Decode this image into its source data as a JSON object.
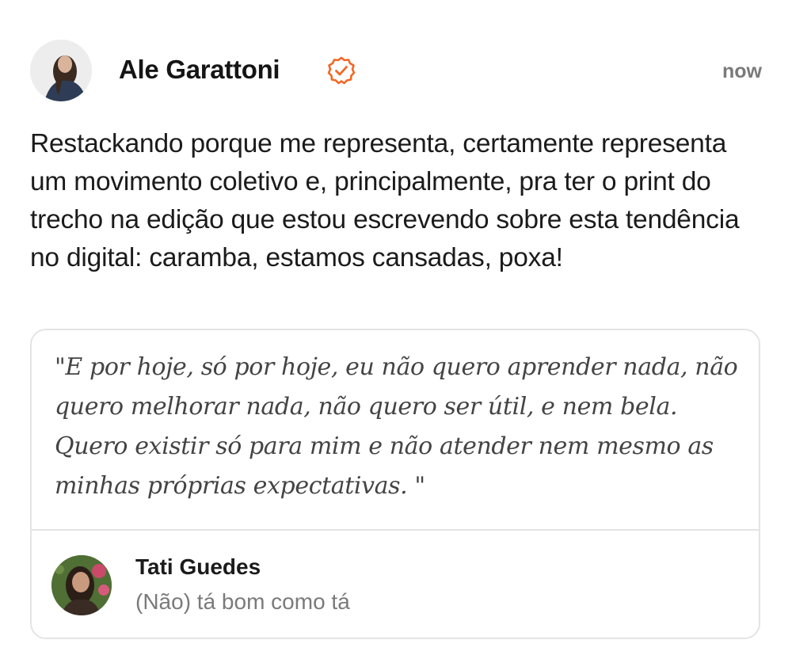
{
  "post": {
    "author": {
      "name": "Ale Garattoni",
      "verified_icon": "verified-badge-icon"
    },
    "timestamp": "now",
    "text": "Restackando porque me representa, certamente representa um movimento coletivo e, principalmente, pra ter o print do trecho na edição que estou escrevendo sobre esta tendência no digital: caramba, estamos cansadas, poxa!"
  },
  "quote": {
    "text": "\"E por hoje, só por hoje, eu não quero aprender nada, não quero melhorar nada, não quero ser útil, e nem bela. Quero existir só para mim e não atender nem mesmo as minhas próprias expectativas. \"",
    "source": {
      "author": "Tati Guedes",
      "publication": "(Não) tá bom como tá"
    }
  },
  "colors": {
    "accent": "#f26722",
    "text": "#1b1b1b",
    "muted": "#7a7a7a",
    "border": "#e4e4e4"
  }
}
